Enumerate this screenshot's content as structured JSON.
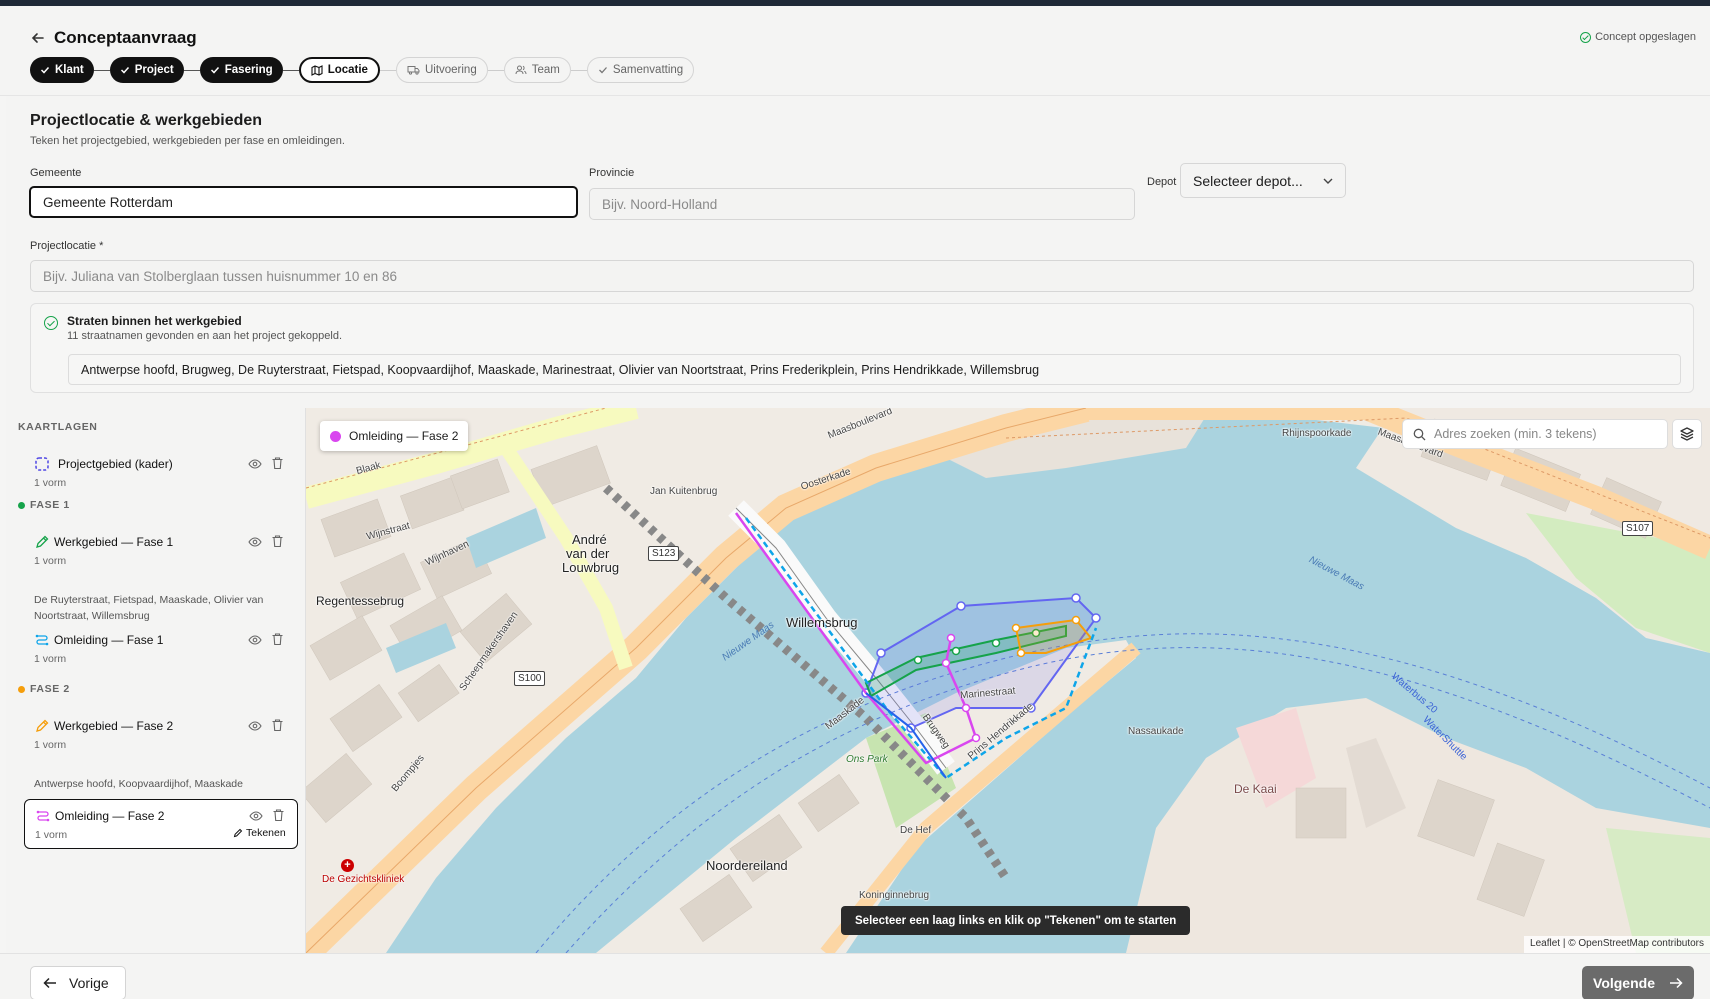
{
  "header": {
    "title": "Conceptaanvraag",
    "saved_status": "Concept opgeslagen"
  },
  "steps": [
    {
      "label": "Klant",
      "state": "done"
    },
    {
      "label": "Project",
      "state": "done"
    },
    {
      "label": "Fasering",
      "state": "done"
    },
    {
      "label": "Locatie",
      "state": "active"
    },
    {
      "label": "Uitvoering",
      "state": "todo"
    },
    {
      "label": "Team",
      "state": "todo"
    },
    {
      "label": "Samenvatting",
      "state": "todo"
    }
  ],
  "section": {
    "title": "Projectlocatie & werkgebieden",
    "subtitle": "Teken het projectgebied, werkgebieden per fase en omleidingen."
  },
  "form": {
    "gemeente": {
      "label": "Gemeente",
      "value": "Gemeente Rotterdam"
    },
    "provincie": {
      "label": "Provincie",
      "placeholder": "Bijv. Noord-Holland"
    },
    "depot": {
      "label": "Depot",
      "value": "Selecteer depot..."
    },
    "projectlocatie": {
      "label": "Projectlocatie *",
      "placeholder": "Bijv. Juliana van Stolberglaan tussen huisnummer 10 en 86"
    }
  },
  "streets": {
    "title": "Straten binnen het werkgebied",
    "subtitle": "11 straatnamen gevonden en aan het project gekoppeld.",
    "list": "Antwerpse hoofd, Brugweg, De Ruyterstraat, Fietspad, Koopvaardijhof, Maaskade, Marinestraat, Olivier van Noortstraat, Prins Frederikplein, Prins Hendrikkade, Willemsbrug"
  },
  "sidebar": {
    "heading": "KAARTLAGEN",
    "project_layer": {
      "name": "Projectgebied (kader)",
      "count": "1 vorm"
    },
    "phase1": {
      "heading": "FASE 1",
      "color": "#16a34a",
      "work": {
        "name": "Werkgebied — Fase 1",
        "count": "1 vorm",
        "icon": "pencil-icon",
        "color": "#16a34a"
      },
      "streets": "De Ruyterstraat, Fietspad, Maaskade, Olivier van Noortstraat, Willemsbrug",
      "detour": {
        "name": "Omleiding — Fase 1",
        "count": "1 vorm",
        "icon": "route-icon",
        "color": "#0ea5e9"
      }
    },
    "phase2": {
      "heading": "FASE 2",
      "color": "#f59e0b",
      "work": {
        "name": "Werkgebied — Fase 2",
        "count": "1 vorm",
        "icon": "pencil-icon",
        "color": "#f59e0b"
      },
      "streets": "Antwerpse hoofd, Koopvaardijhof, Maaskade",
      "detour": {
        "name": "Omleiding — Fase 2",
        "count": "1 vorm",
        "icon": "route-icon",
        "color": "#d946ef",
        "draw_label": "Tekenen"
      }
    }
  },
  "map": {
    "active_layer": "Omleiding — Fase 2",
    "active_color": "#d946ef",
    "search_placeholder": "Adres zoeken (min. 3 tekens)",
    "hint": "Selecteer een laag links en klik op \"Tekenen\" om te starten",
    "attribution_leaflet": "Leaflet",
    "attribution_osm": "© OpenStreetMap contributors",
    "labels": {
      "willemsbrug": "Willemsbrug",
      "andre": "André",
      "van_der": "van der",
      "louwbrug": "Louwbrug",
      "regentessebrug": "Regentessebrug",
      "noordereiland": "Noordereiland",
      "de_kaai": "De Kaai",
      "de_hef": "De Hef",
      "koninginnebrug": "Koninginnebrug",
      "maasboulevard": "Maasboulevard",
      "maasboulevard2": "Maasboulevard",
      "boompjes": "Boompjes",
      "blaak": "Blaak",
      "nieuwe_maas": "Nieuwe Maas",
      "nieuwe_maas2": "Nieuwe Maas",
      "clinic": "De Gezichtskliniek",
      "ons_park": "Ons Park",
      "oosterkade": "Oosterkade",
      "jan_kuitenbrug": "Jan Kuitenbrug",
      "wijnhaven": "Wijnhaven",
      "wijnstraat": "Wijnstraat",
      "maaskade": "Maaskade",
      "brugweg": "Brugweg",
      "prins_hendrikkade": "Prins Hendrikkade",
      "nassaukade": "Nassaukade",
      "waterbus20": "Waterbus 20",
      "watershuttle": "WaterShuttle",
      "rhijnspoorkade": "Rhijnspoorkade",
      "scheepmakershaven": "Scheepmakershaven",
      "marinestraat": "Marinestraat"
    },
    "shields": {
      "s123": "S123",
      "s100": "S100",
      "s107": "S107"
    }
  },
  "footer": {
    "prev": "Vorige",
    "next": "Volgende"
  }
}
